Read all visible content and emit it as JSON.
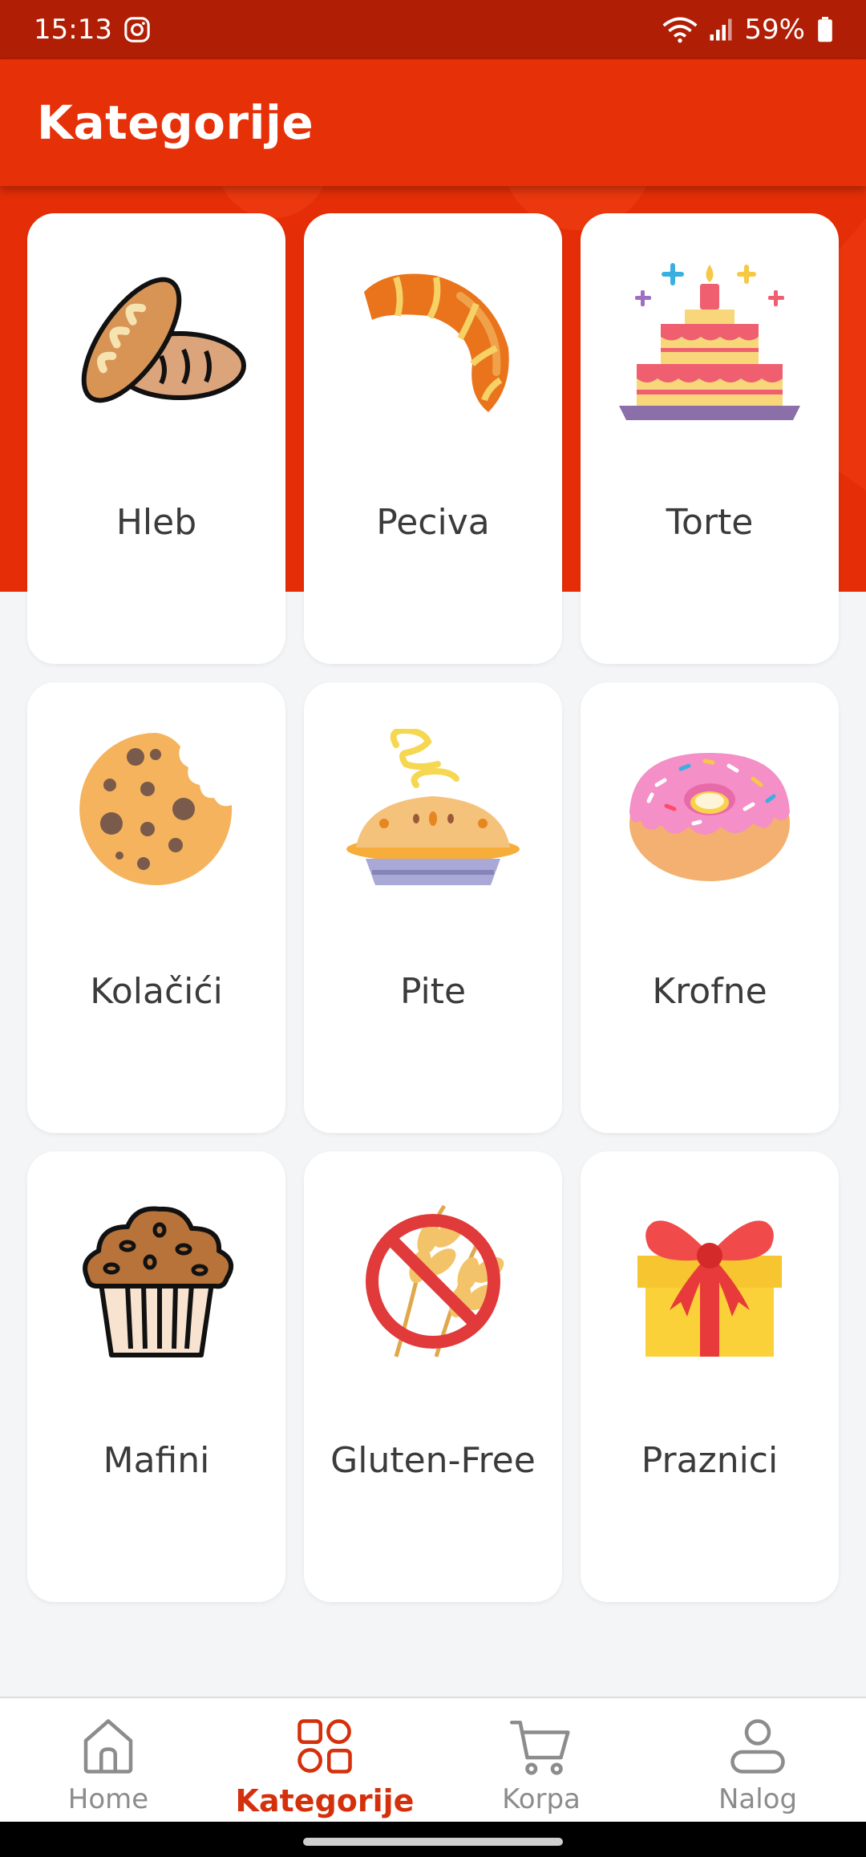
{
  "status": {
    "time": "15:13",
    "battery": "59%"
  },
  "app_bar": {
    "title": "Kategorije"
  },
  "categories": [
    {
      "label": "Hleb",
      "icon": "bread-icon"
    },
    {
      "label": "Peciva",
      "icon": "croissant-icon"
    },
    {
      "label": "Torte",
      "icon": "cake-icon"
    },
    {
      "label": "Kolačići",
      "icon": "cookie-icon"
    },
    {
      "label": "Pite",
      "icon": "pie-icon"
    },
    {
      "label": "Krofne",
      "icon": "donut-icon"
    },
    {
      "label": "Mafini",
      "icon": "muffin-icon"
    },
    {
      "label": "Gluten-Free",
      "icon": "gluten-free-icon"
    },
    {
      "label": "Praznici",
      "icon": "gift-icon"
    }
  ],
  "bottom_nav": {
    "items": [
      {
        "label": "Home",
        "icon": "home-icon"
      },
      {
        "label": "Kategorije",
        "icon": "categories-icon",
        "active": true
      },
      {
        "label": "Korpa",
        "icon": "cart-icon"
      },
      {
        "label": "Nalog",
        "icon": "account-icon"
      }
    ]
  },
  "colors": {
    "primary": "#e63008",
    "status_bar": "#b01e05",
    "active_nav": "#d5300c"
  }
}
